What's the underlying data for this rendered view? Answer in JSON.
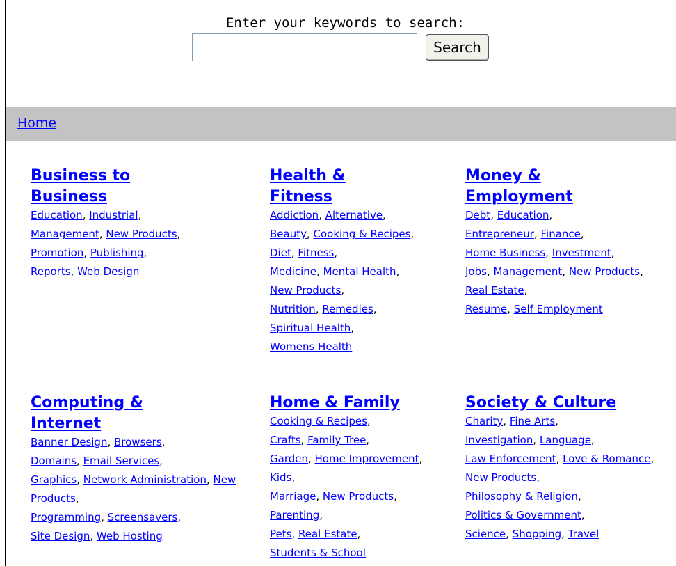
{
  "search": {
    "prompt": "Enter your keywords to search:",
    "input_value": "",
    "button_label": "Search"
  },
  "nav": {
    "home": "Home"
  },
  "categories": [
    {
      "title": "Business to Business",
      "links": [
        "Education",
        "Industrial",
        "Management",
        "New Products",
        "Promotion",
        "Publishing",
        "Reports",
        "Web Design"
      ]
    },
    {
      "title": "Health & Fitness",
      "links": [
        "Addiction",
        "Alternative",
        "Beauty",
        "Cooking & Recipes",
        "Diet",
        "Fitness",
        "Medicine",
        "Mental Health",
        "New Products",
        "Nutrition",
        "Remedies",
        "Spiritual Health",
        "Womens Health"
      ]
    },
    {
      "title": "Money & Employment",
      "links": [
        "Debt",
        "Education",
        "Entrepreneur",
        "Finance",
        "Home Business",
        "Investment",
        "Jobs",
        "Management",
        "New Products",
        "Real Estate",
        "Resume",
        "Self Employment"
      ]
    },
    {
      "title": "Computing & Internet",
      "links": [
        "Banner Design",
        "Browsers",
        "Domains",
        "Email Services",
        "Graphics",
        "Network Administration",
        "New Products",
        "Programming",
        "Screensavers",
        "Site Design",
        "Web Hosting"
      ]
    },
    {
      "title": "Home & Family",
      "links": [
        "Cooking & Recipes",
        "Crafts",
        "Family Tree",
        "Garden",
        "Home Improvement",
        "Kids",
        "Marriage",
        "New Products",
        "Parenting",
        "Pets",
        "Real Estate",
        "Students & School"
      ]
    },
    {
      "title": "Society & Culture",
      "links": [
        "Charity",
        "Fine Arts",
        "Investigation",
        "Language",
        "Law Enforcement",
        "Love & Romance",
        "New Products",
        "Philosophy & Religion",
        "Politics & Government",
        "Science",
        "Shopping",
        "Travel"
      ]
    }
  ]
}
